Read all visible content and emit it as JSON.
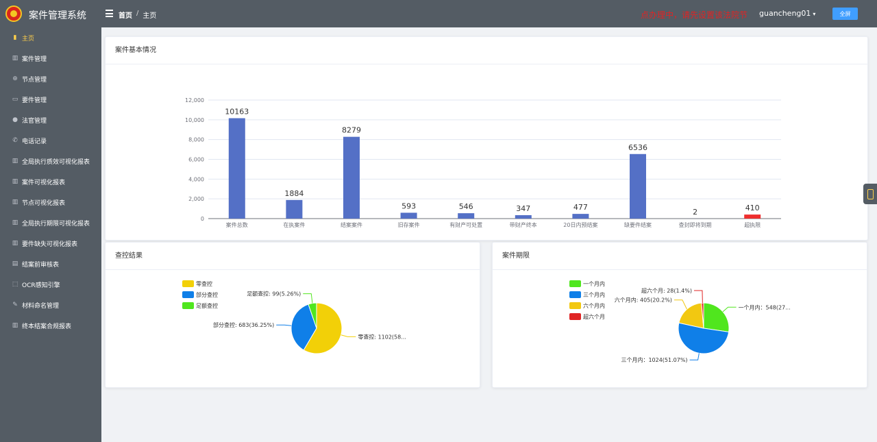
{
  "app": {
    "title": "案件管理系统"
  },
  "breadcrumb": {
    "home": "首页",
    "current": "主页"
  },
  "header": {
    "notice": "点办理中，请先设置该法院节",
    "user": "guancheng01",
    "fullscreen": "全屏"
  },
  "sidebar": {
    "items": [
      {
        "label": "主页",
        "icon": "book-icon"
      },
      {
        "label": "案件管理",
        "icon": "library-icon"
      },
      {
        "label": "节点管理",
        "icon": "circle-plus-icon"
      },
      {
        "label": "要件管理",
        "icon": "folder-icon"
      },
      {
        "label": "法官管理",
        "icon": "user-icon"
      },
      {
        "label": "电话记录",
        "icon": "phone-icon"
      },
      {
        "label": "全局执行质效可视化报表",
        "icon": "bar-chart-icon"
      },
      {
        "label": "案件可视化报表",
        "icon": "bar-chart-icon"
      },
      {
        "label": "节点可视化报表",
        "icon": "bar-chart-icon"
      },
      {
        "label": "全局执行期限可视化报表",
        "icon": "bar-chart-icon"
      },
      {
        "label": "要件缺失可视化报表",
        "icon": "bar-chart-icon"
      },
      {
        "label": "结案前审核表",
        "icon": "document-icon"
      },
      {
        "label": "OCR感知引擎",
        "icon": "scan-icon"
      },
      {
        "label": "材料命名管理",
        "icon": "edit-icon"
      },
      {
        "label": "终本结案合规报表",
        "icon": "bar-chart-icon"
      }
    ]
  },
  "cards": {
    "basic": {
      "title": "案件基本情况"
    },
    "control": {
      "title": "查控结果"
    },
    "term": {
      "title": "案件期限"
    }
  },
  "colors": {
    "bar": "#5470c6",
    "bar_highlight": "#ee2e2e",
    "accent": "#ffd04b",
    "sidebar": "#545c64",
    "button": "#409eff"
  },
  "chart_data": [
    {
      "type": "bar",
      "title": "",
      "categories": [
        "案件总数",
        "在执案件",
        "结案案件",
        "旧存案件",
        "有财产可处置",
        "带财产终本",
        "20日内预结案",
        "缺要件结案",
        "查封即将到期",
        "超执限"
      ],
      "values": [
        10163,
        1884,
        8279,
        593,
        546,
        347,
        477,
        6536,
        2,
        410
      ],
      "highlight_index": 9,
      "yticks": [
        "0",
        "2,000",
        "4,000",
        "6,000",
        "8,000",
        "10,000",
        "12,000"
      ],
      "ylim": [
        0,
        12000
      ],
      "grid": true
    },
    {
      "type": "pie",
      "title": "",
      "legend_position": "top-left",
      "slices": [
        {
          "name": "零查控",
          "value": 1102,
          "label": "零查控: 1102(58...",
          "color": "#f2d008"
        },
        {
          "name": "部分查控",
          "value": 683,
          "label": "部分查控: 683(36.25%)",
          "color": "#0f7fe8"
        },
        {
          "name": "足额查控",
          "value": 99,
          "label": "足额查控: 99(5.26%)",
          "color": "#50e61e"
        }
      ]
    },
    {
      "type": "pie",
      "title": "",
      "legend_position": "top-left",
      "slices": [
        {
          "name": "一个月内",
          "value": 548,
          "label": "一个月内：548(27...",
          "color": "#50e61e"
        },
        {
          "name": "三个月内",
          "value": 1024,
          "label": "三个月内：1024(51.07%)",
          "color": "#0f7fe8"
        },
        {
          "name": "六个月内",
          "value": 405,
          "label": "六个月内: 405(20.2%)",
          "color": "#f2c811"
        },
        {
          "name": "超六个月",
          "value": 28,
          "label": "超六个月: 28(1.4%)",
          "color": "#e02424"
        }
      ]
    }
  ]
}
